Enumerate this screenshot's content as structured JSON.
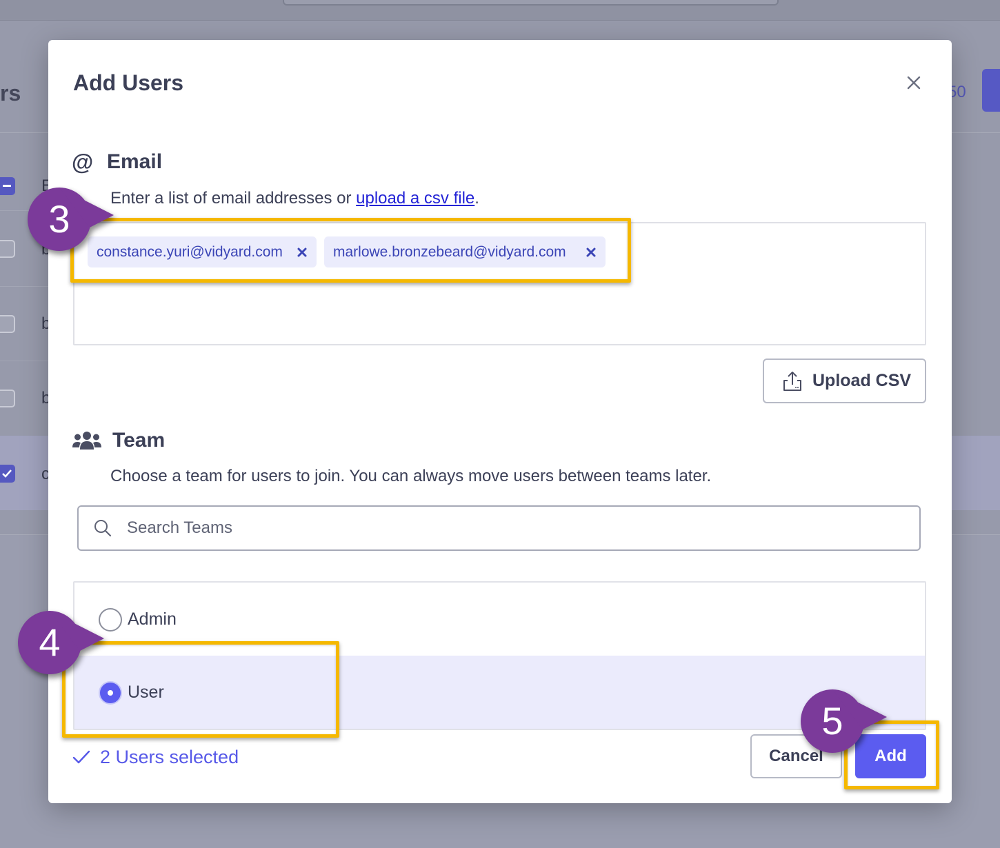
{
  "background": {
    "title_fragment": "rs",
    "count_fragment": "50",
    "row_fragments": [
      "E",
      "b",
      "b",
      "b",
      "c"
    ]
  },
  "modal": {
    "title": "Add Users",
    "close_icon": "close-icon",
    "email_section": {
      "icon": "at-sign-icon",
      "icon_glyph": "@",
      "heading": "Email",
      "description_prefix": "Enter a list of email addresses or ",
      "upload_link": "upload a csv file",
      "description_suffix": ".",
      "chips": [
        {
          "email": "constance.yuri@vidyard.com",
          "remove_icon": "close-icon"
        },
        {
          "email": "marlowe.bronzebeard@vidyard.com",
          "remove_icon": "close-icon"
        }
      ],
      "upload_button": {
        "icon": "upload-icon",
        "label": "Upload CSV"
      }
    },
    "team_section": {
      "icon": "users-group-icon",
      "heading": "Team",
      "description": "Choose a team for users to join. You can always move users between teams later.",
      "search": {
        "icon": "search-icon",
        "placeholder": "Search Teams",
        "value": ""
      },
      "roles": [
        {
          "label": "Admin",
          "selected": false
        },
        {
          "label": "User",
          "selected": true
        }
      ]
    },
    "footer": {
      "selected_icon": "check-icon",
      "selected_text": "2 Users selected",
      "cancel_label": "Cancel",
      "add_label": "Add"
    }
  },
  "annotations": {
    "step_markers": [
      {
        "number": "3"
      },
      {
        "number": "4"
      },
      {
        "number": "5"
      }
    ]
  },
  "colors": {
    "accent": "#5B5CF0",
    "link": "#2323D6",
    "chip_background": "#EBECFC",
    "chip_text": "#3B45B6",
    "highlight": "#F5B800",
    "marker": "#7B3A9A",
    "text": "#3C4057"
  }
}
